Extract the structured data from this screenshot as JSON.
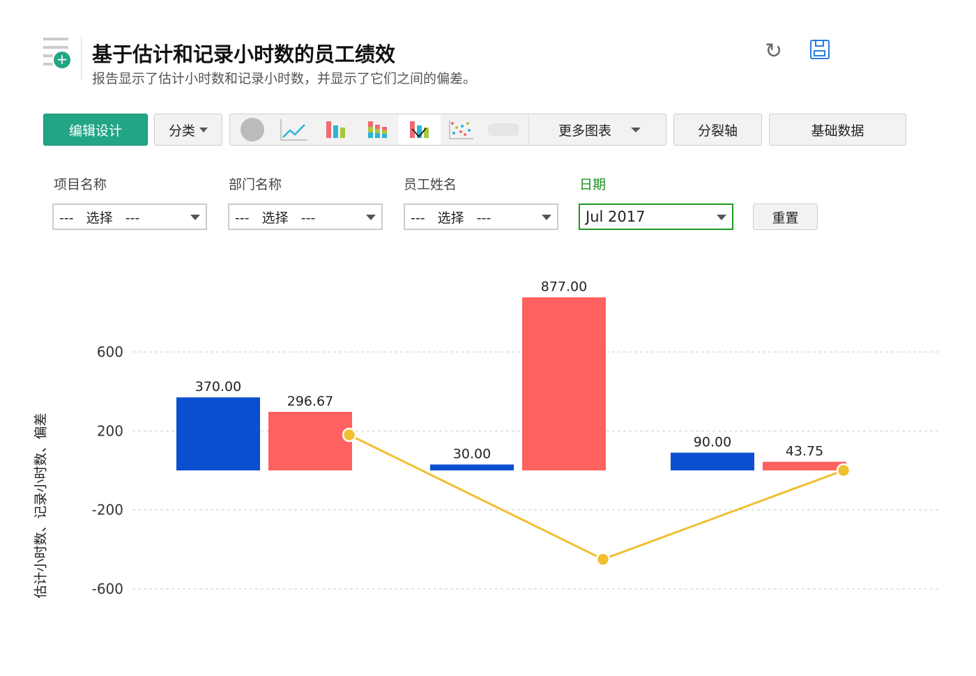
{
  "header": {
    "title": "基于估计和记录小时数的员工绩效",
    "subtitle": "报告显示了估计小时数和记录小时数，并显示了它们之间的偏差。"
  },
  "toolbar": {
    "edit_design": "编辑设计",
    "category": "分类",
    "more_charts": "更多图表",
    "split_axis": "分裂轴",
    "base_data": "基础数据"
  },
  "filters": [
    {
      "label": "项目名称",
      "value": "---   选择   ---"
    },
    {
      "label": "部门名称",
      "value": "---   选择   ---"
    },
    {
      "label": "员工姓名",
      "value": "---   选择   ---"
    },
    {
      "label": "日期",
      "value": "Jul 2017"
    }
  ],
  "reset": "重置",
  "colors": {
    "estimated": "#0a4fcf",
    "logged": "#ff6060",
    "variance": "#f0c030",
    "accent": "#22a584",
    "date_label": "#1a8f1a"
  },
  "chart_data": {
    "type": "bar",
    "ylabel": "估计小时数、记录小时数、偏差",
    "yticks": [
      600,
      200,
      -200,
      -600
    ],
    "ylim": [
      -700,
      1000
    ],
    "grid": true,
    "groups": 3,
    "series": [
      {
        "name": "估计小时数",
        "values": [
          370.0,
          30.0,
          90.0
        ],
        "labels": [
          "370.00",
          "30.00",
          "90.00"
        ]
      },
      {
        "name": "记录小时数",
        "values": [
          296.67,
          877.0,
          43.75
        ],
        "labels": [
          "296.67",
          "877.00",
          "43.75"
        ]
      },
      {
        "name": "偏差",
        "type": "line",
        "values": [
          180,
          -450,
          0
        ]
      }
    ]
  }
}
